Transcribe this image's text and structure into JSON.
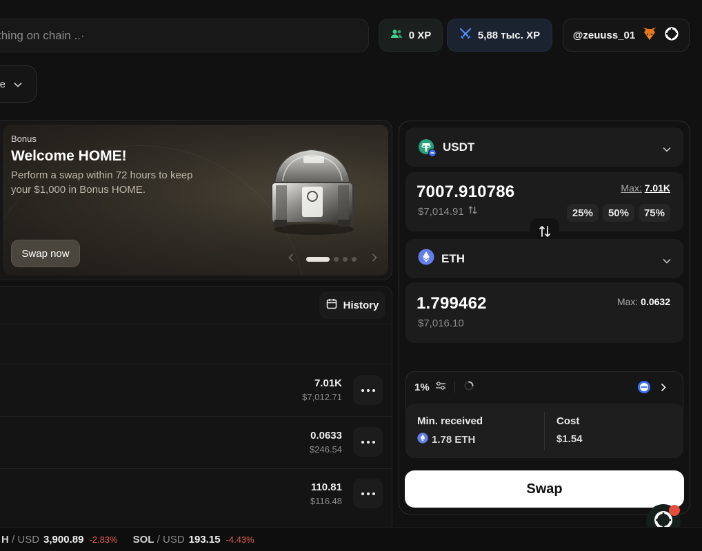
{
  "header": {
    "search_placeholder": "thing on chain ..·",
    "xp_pill": "0 XP",
    "xp_pill2": "5,88 тыс. XP",
    "username": "@zeuuss_01"
  },
  "filter": {
    "label": "e"
  },
  "banner": {
    "tag": "Bonus",
    "title": "Welcome HOME!",
    "description": "Perform a swap within 72 hours to keep your $1,000 in Bonus HOME.",
    "cta": "Swap now"
  },
  "list": {
    "history_label": "History",
    "rows": [
      {
        "value": "7.01K",
        "usd": "$7,012.71"
      },
      {
        "value": "0.0633",
        "usd": "$246.54"
      },
      {
        "value": "110.81",
        "usd": "$116.48"
      }
    ]
  },
  "swap": {
    "from": {
      "symbol": "USDT",
      "amount": "7007.910786",
      "usd": "$7,014.91",
      "max_label": "Max:",
      "max_value": "7.01K",
      "percents": [
        "25%",
        "50%",
        "75%"
      ]
    },
    "to": {
      "symbol": "ETH",
      "amount": "1.799462",
      "usd": "$7,016.10",
      "max_label": "Max:",
      "max_value": "0.0632"
    },
    "slippage": "1%",
    "min_received_label": "Min. received",
    "min_received_value": "1.78 ETH",
    "cost_label": "Cost",
    "cost_value": "$1.54",
    "swap_label": "Swap"
  },
  "ticker": [
    {
      "base": "H",
      "quote": "USD",
      "price": "3,900.89",
      "change": "-2.83%"
    },
    {
      "base": "SOL",
      "quote": "USD",
      "price": "193.15",
      "change": "-4.43%"
    }
  ],
  "colors": {
    "background": "#111111",
    "accent_white": "#ffffff",
    "negative": "#e05a4f",
    "usdt": "#26a17b",
    "eth": "#627eea"
  }
}
